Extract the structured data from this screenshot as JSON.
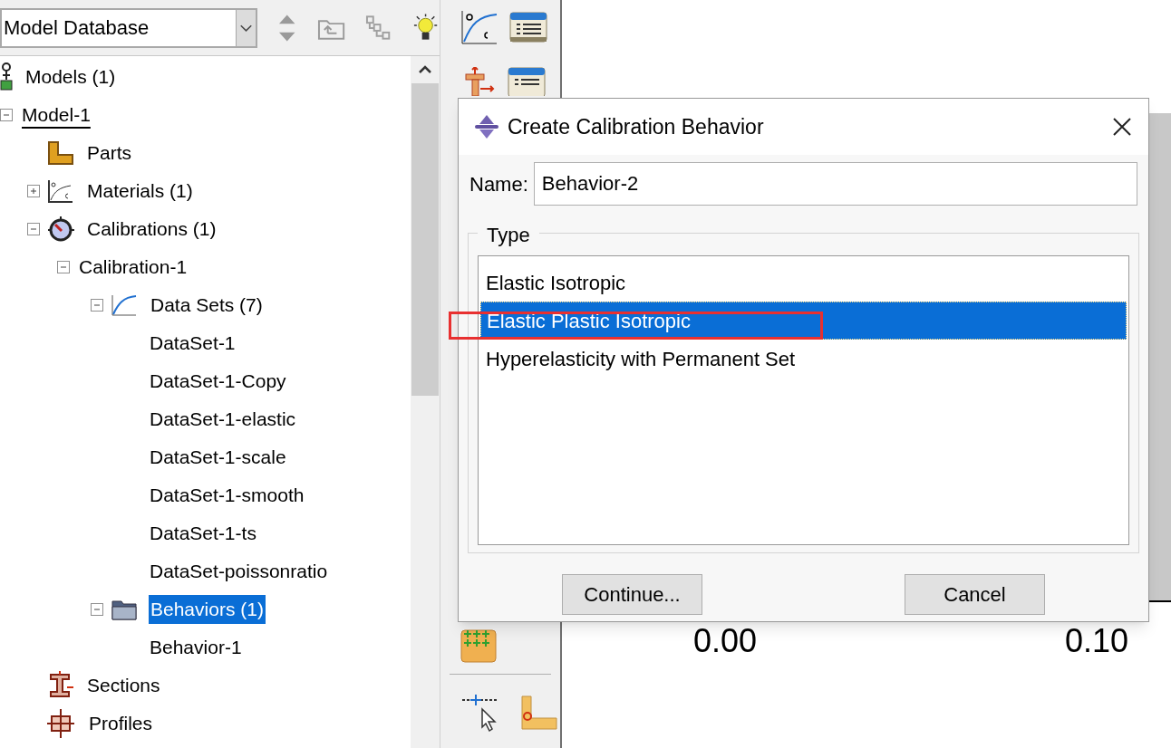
{
  "model_selector": {
    "value": "Model Database"
  },
  "tree": [
    {
      "label": "Models (1)",
      "kind": "models",
      "selected": false,
      "children": [
        {
          "label": "Model-1",
          "current": true,
          "selected": false,
          "expanded": true,
          "children": [
            {
              "label": "Parts",
              "kind": "parts",
              "selected": false
            },
            {
              "label": "Materials (1)",
              "kind": "materials",
              "selected": false,
              "expanded": false
            },
            {
              "label": "Calibrations (1)",
              "kind": "calibrations",
              "selected": false,
              "expanded": true,
              "children": [
                {
                  "label": "Calibration-1",
                  "selected": false,
                  "expanded": true,
                  "children": [
                    {
                      "label": "Data Sets (7)",
                      "kind": "datasets",
                      "selected": false,
                      "expanded": true,
                      "children": [
                        {
                          "label": "DataSet-1",
                          "selected": false
                        },
                        {
                          "label": "DataSet-1-Copy",
                          "selected": false
                        },
                        {
                          "label": "DataSet-1-elastic",
                          "selected": false
                        },
                        {
                          "label": "DataSet-1-scale",
                          "selected": false
                        },
                        {
                          "label": "DataSet-1-smooth",
                          "selected": false
                        },
                        {
                          "label": "DataSet-1-ts",
                          "selected": false
                        },
                        {
                          "label": "DataSet-poissonratio",
                          "selected": false
                        }
                      ]
                    },
                    {
                      "label": "Behaviors (1)",
                      "kind": "behaviors",
                      "selected": true,
                      "expanded": true,
                      "children": [
                        {
                          "label": "Behavior-1",
                          "selected": false
                        }
                      ]
                    }
                  ]
                }
              ]
            },
            {
              "label": "Sections",
              "kind": "sections",
              "selected": false
            },
            {
              "label": "Profiles",
              "kind": "profiles",
              "selected": false
            }
          ]
        }
      ]
    }
  ],
  "plot": {
    "tick_labels": [
      "0.00",
      "0.10"
    ]
  },
  "dialog": {
    "title": "Create Calibration Behavior",
    "name_label": "Name:",
    "name_value": "Behavior-2",
    "type_group": "Type",
    "types": [
      {
        "label": "Elastic Isotropic",
        "selected": false
      },
      {
        "label": "Elastic Plastic Isotropic",
        "selected": true
      },
      {
        "label": "Hyperelasticity with Permanent Set",
        "selected": false
      }
    ],
    "buttons": [
      "Continue...",
      "Cancel"
    ]
  }
}
